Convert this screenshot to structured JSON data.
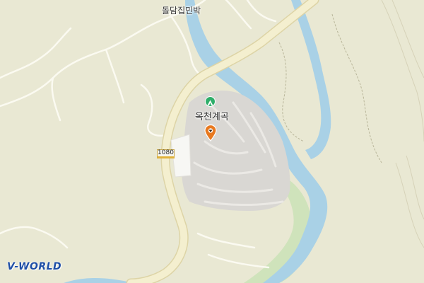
{
  "map": {
    "place_label": "돌담집민박",
    "poi": {
      "name": "옥천계곡",
      "icon": "campsite-icon"
    },
    "road_shield": {
      "number": "1080"
    },
    "selected_marker": {
      "icon": "location-pin-icon",
      "color": "#e8791f"
    },
    "logo_text": "V-WORLD",
    "colors": {
      "land": "#e9e8d3",
      "water": "#a9d1e6",
      "road": "#f4efcf",
      "road_casing": "#ddd4a6",
      "parking_area": "#d9d7d3",
      "building": "#f7f7f4",
      "grass": "#cfe3bb",
      "trail": "#b9b69a",
      "logo": "#1f4fa6"
    }
  }
}
